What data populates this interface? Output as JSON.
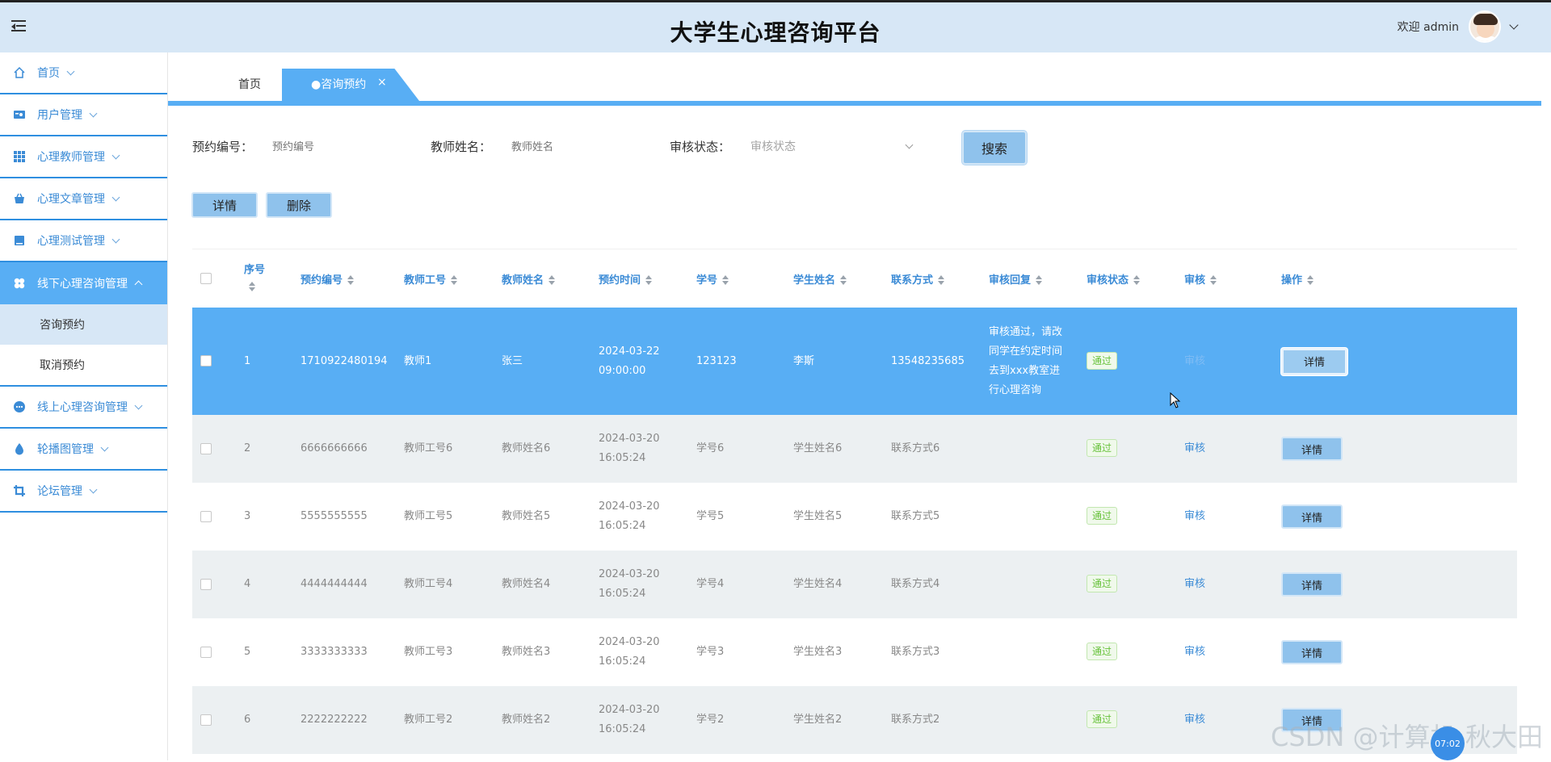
{
  "header": {
    "title": "大学生心理咨询平台",
    "welcome": "欢迎 admin"
  },
  "sidebar": {
    "items": [
      {
        "label": "首页",
        "icon": "home-icon"
      },
      {
        "label": "用户管理",
        "icon": "user-card-icon"
      },
      {
        "label": "心理教师管理",
        "icon": "grid-icon"
      },
      {
        "label": "心理文章管理",
        "icon": "basket-icon"
      },
      {
        "label": "心理测试管理",
        "icon": "tablet-icon"
      },
      {
        "label": "线下心理咨询管理",
        "icon": "flower-icon"
      },
      {
        "label": "线上心理咨询管理",
        "icon": "chat-dots-icon"
      },
      {
        "label": "轮播图管理",
        "icon": "drop-icon"
      },
      {
        "label": "论坛管理",
        "icon": "crop-icon"
      }
    ],
    "sub": [
      "咨询预约",
      "取消预约"
    ]
  },
  "tabs": {
    "home": "首页",
    "active": "●咨询预约",
    "close": "×"
  },
  "search": {
    "booking_label": "预约编号：",
    "booking_placeholder": "预约编号",
    "teacher_label": "教师姓名：",
    "teacher_placeholder": "教师姓名",
    "status_label": "审核状态：",
    "status_placeholder": "审核状态",
    "search_btn": "搜索"
  },
  "actions": {
    "detail": "详情",
    "delete": "删除"
  },
  "table": {
    "headers": [
      "序号",
      "预约编号",
      "教师工号",
      "教师姓名",
      "预约时间",
      "学号",
      "学生姓名",
      "联系方式",
      "审核回复",
      "审核状态",
      "审核",
      "操作"
    ],
    "rows": [
      {
        "idx": "1",
        "booking": "1710922480194",
        "teacher_no": "教师1",
        "teacher_name": "张三",
        "time": "2024-03-22 09:00:00",
        "student_no": "123123",
        "student_name": "李斯",
        "contact": "13548235685",
        "reply": "审核通过，请改同学在约定时间去到xxx教室进行心理咨询",
        "status": "通过",
        "audit": "审核",
        "op": "详情"
      },
      {
        "idx": "2",
        "booking": "6666666666",
        "teacher_no": "教师工号6",
        "teacher_name": "教师姓名6",
        "time": "2024-03-20 16:05:24",
        "student_no": "学号6",
        "student_name": "学生姓名6",
        "contact": "联系方式6",
        "reply": "",
        "status": "通过",
        "audit": "审核",
        "op": "详情"
      },
      {
        "idx": "3",
        "booking": "5555555555",
        "teacher_no": "教师工号5",
        "teacher_name": "教师姓名5",
        "time": "2024-03-20 16:05:24",
        "student_no": "学号5",
        "student_name": "学生姓名5",
        "contact": "联系方式5",
        "reply": "",
        "status": "通过",
        "audit": "审核",
        "op": "详情"
      },
      {
        "idx": "4",
        "booking": "4444444444",
        "teacher_no": "教师工号4",
        "teacher_name": "教师姓名4",
        "time": "2024-03-20 16:05:24",
        "student_no": "学号4",
        "student_name": "学生姓名4",
        "contact": "联系方式4",
        "reply": "",
        "status": "通过",
        "audit": "审核",
        "op": "详情"
      },
      {
        "idx": "5",
        "booking": "3333333333",
        "teacher_no": "教师工号3",
        "teacher_name": "教师姓名3",
        "time": "2024-03-20 16:05:24",
        "student_no": "学号3",
        "student_name": "学生姓名3",
        "contact": "联系方式3",
        "reply": "",
        "status": "通过",
        "audit": "审核",
        "op": "详情"
      },
      {
        "idx": "6",
        "booking": "2222222222",
        "teacher_no": "教师工号2",
        "teacher_name": "教师姓名2",
        "time": "2024-03-20 16:05:24",
        "student_no": "学号2",
        "student_name": "学生姓名2",
        "contact": "联系方式2",
        "reply": "",
        "status": "通过",
        "audit": "审核",
        "op": "详情"
      }
    ]
  },
  "watermark": "CSDN @计算机-秋大田",
  "float_badge": "07:02",
  "colors": {
    "accent": "#58aef4",
    "header_bg": "#d7e7f6",
    "link": "#3b8bd6",
    "button": "#8fc2ec"
  }
}
